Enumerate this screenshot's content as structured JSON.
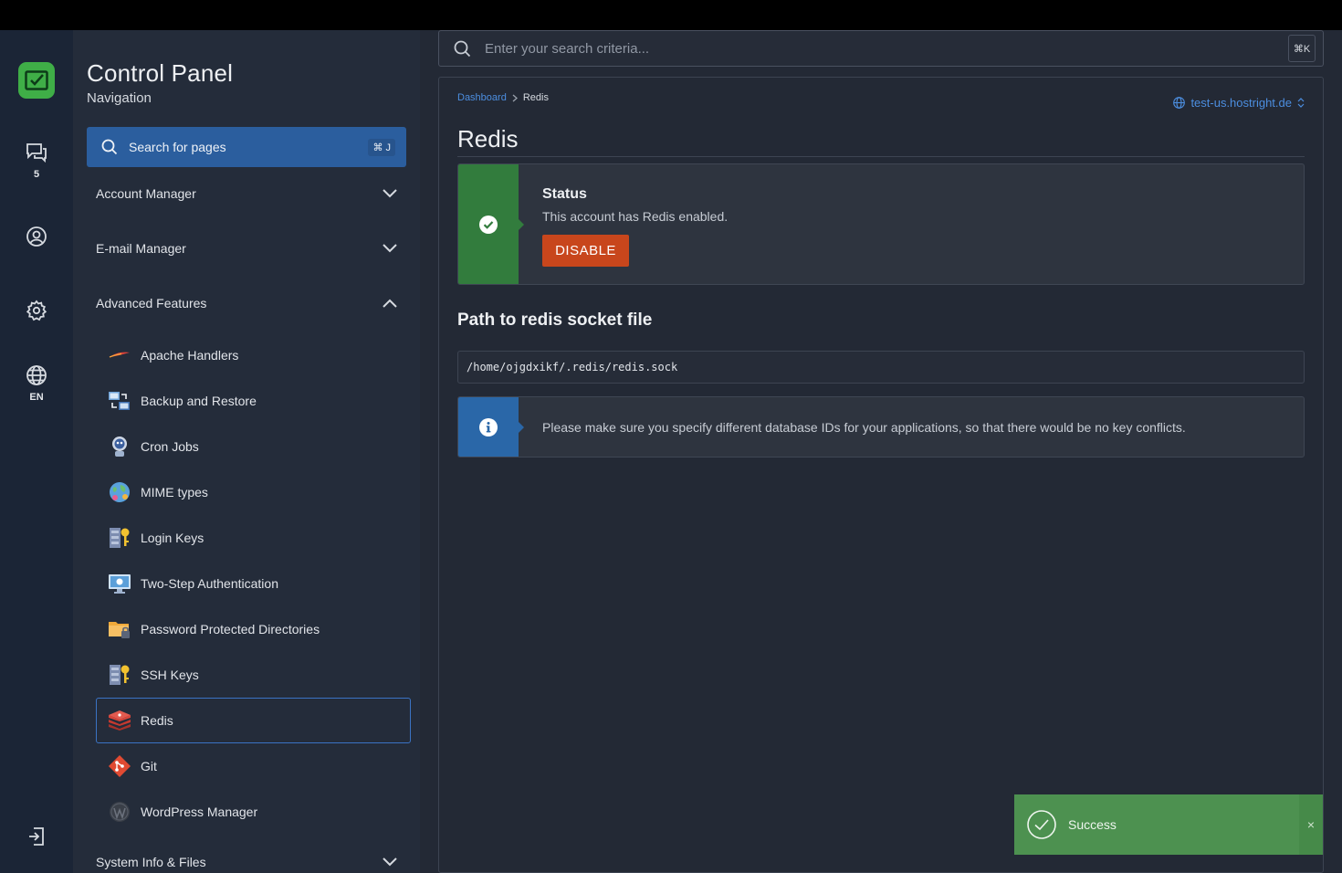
{
  "rail": {
    "chat_count": "5",
    "language": "EN"
  },
  "nav": {
    "title": "Control Panel",
    "subtitle": "Navigation",
    "search_label": "Search for pages",
    "search_shortcut": "⌘ J",
    "sections": {
      "account": "Account Manager",
      "email": "E-mail Manager",
      "advanced": "Advanced Features",
      "system": "System Info & Files"
    },
    "items": [
      {
        "label": "Apache Handlers",
        "icon": "apache-feather-icon"
      },
      {
        "label": "Backup and Restore",
        "icon": "backup-icon"
      },
      {
        "label": "Cron Jobs",
        "icon": "cron-robot-icon"
      },
      {
        "label": "MIME types",
        "icon": "mime-globe-icon"
      },
      {
        "label": "Login Keys",
        "icon": "login-keys-icon"
      },
      {
        "label": "Two-Step Authentication",
        "icon": "two-step-monitor-icon"
      },
      {
        "label": "Password Protected Directories",
        "icon": "folder-lock-icon"
      },
      {
        "label": "SSH Keys",
        "icon": "ssh-keys-icon"
      },
      {
        "label": "Redis",
        "icon": "redis-icon",
        "active": true
      },
      {
        "label": "Git",
        "icon": "git-icon"
      },
      {
        "label": "WordPress Manager",
        "icon": "wordpress-icon"
      }
    ]
  },
  "main": {
    "search_placeholder": "Enter your search criteria...",
    "search_shortcut": "⌘K",
    "breadcrumb": {
      "root": "Dashboard",
      "current": "Redis"
    },
    "domain": "test-us.hostright.de",
    "title": "Redis",
    "status": {
      "heading": "Status",
      "text": "This account has Redis enabled.",
      "button": "DISABLE"
    },
    "socket": {
      "heading": "Path to redis socket file",
      "path": "/home/ojgdxikf/.redis/redis.sock"
    },
    "info": "Please make sure you specify different database IDs for your applications, so that there would be no key conflicts."
  },
  "toast": {
    "text": "Success",
    "close": "×"
  },
  "colors": {
    "brand": "#3fae47",
    "accent": "#2b5e9e",
    "link": "#4c8ee0",
    "success": "#327c3d",
    "danger": "#c8461c",
    "info": "#2a67a8"
  }
}
